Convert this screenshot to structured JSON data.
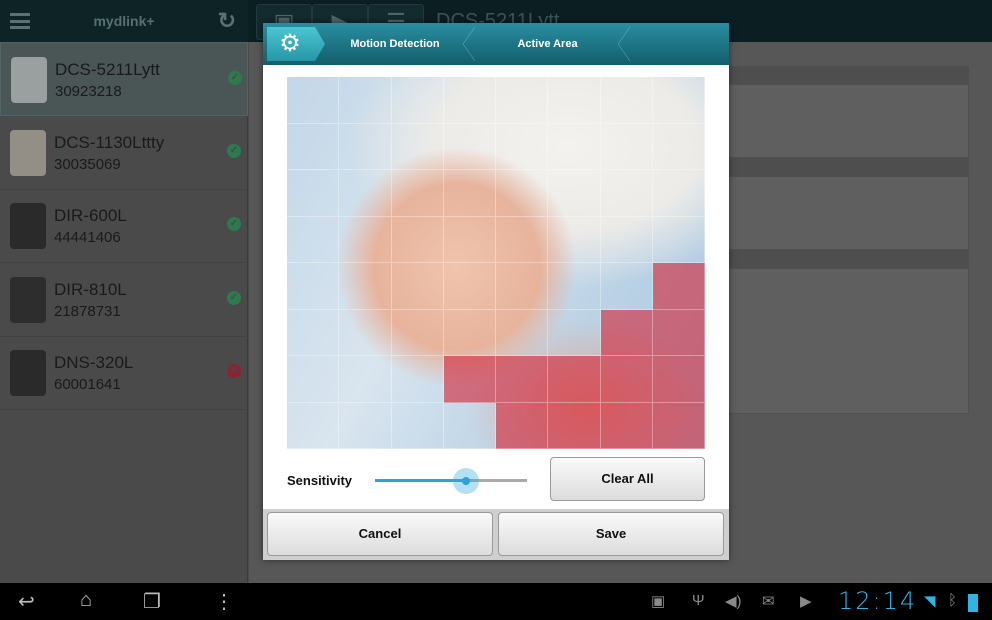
{
  "app": {
    "title": "mydlink+",
    "device_title": "DCS-5211Lytt"
  },
  "devices": [
    {
      "name": "DCS-5211Lytt",
      "serial": "30923218",
      "status": "online",
      "selected": true
    },
    {
      "name": "DCS-1130Lttty",
      "serial": "30035069",
      "status": "online"
    },
    {
      "name": "DIR-600L",
      "serial": "44441406",
      "status": "online"
    },
    {
      "name": "DIR-810L",
      "serial": "21878731",
      "status": "online"
    },
    {
      "name": "DNS-320L",
      "serial": "60001641",
      "status": "offline"
    }
  ],
  "dialog": {
    "breadcrumbs": [
      "Motion Detection",
      "Active Area"
    ],
    "grid": {
      "rows": 8,
      "cols": 8,
      "active": [
        [
          4,
          7
        ],
        [
          5,
          6
        ],
        [
          5,
          7
        ],
        [
          6,
          3
        ],
        [
          6,
          4
        ],
        [
          6,
          5
        ],
        [
          6,
          6
        ],
        [
          6,
          7
        ],
        [
          7,
          4
        ],
        [
          7,
          5
        ],
        [
          7,
          6
        ],
        [
          7,
          7
        ]
      ]
    },
    "sensitivity_label": "Sensitivity",
    "sensitivity": 0.6,
    "clear_all": "Clear All",
    "cancel": "Cancel",
    "save": "Save"
  },
  "status_bar": {
    "time": "12:14"
  },
  "colors": {
    "accent": "#2aa5d9",
    "active_area": "#d2283c",
    "online": "#2e9a5a",
    "offline": "#c0283c"
  }
}
